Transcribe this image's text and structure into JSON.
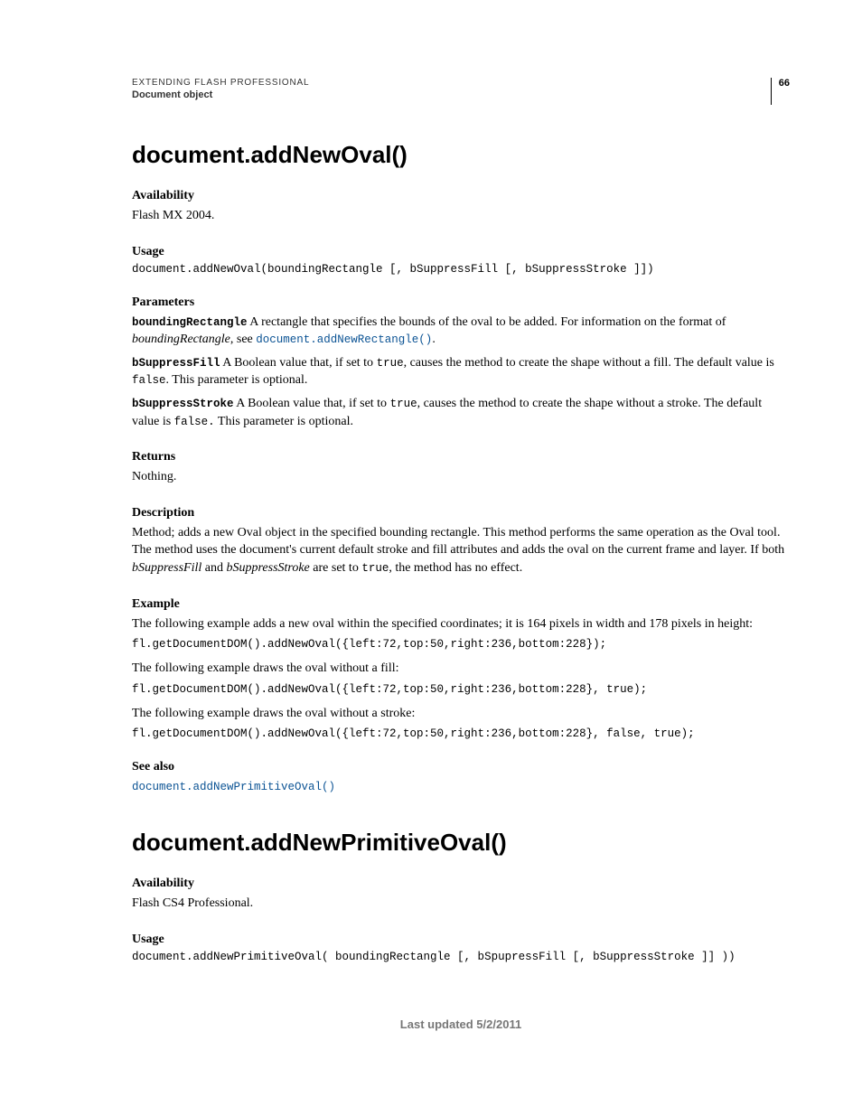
{
  "header": {
    "title": "EXTENDING FLASH PROFESSIONAL",
    "subtitle": "Document object",
    "page": "66"
  },
  "s1": {
    "title": "document.addNewOval()",
    "availability_h": "Availability",
    "availability_v": "Flash MX 2004.",
    "usage_h": "Usage",
    "usage_code": "document.addNewOval(boundingRectangle [, bSuppressFill [, bSuppressStroke ]])",
    "params_h": "Parameters",
    "p1_name": "boundingRectangle",
    "p1_text_a": "  A rectangle that specifies the bounds of the oval to be added. For information on the format of ",
    "p1_text_b_italic": "boundingRectangle",
    "p1_text_c": ", see ",
    "p1_link": "document.addNewRectangle()",
    "p1_text_d": ".",
    "p2_name": "bSuppressFill",
    "p2_text_a": "  A Boolean value that, if set to ",
    "p2_true": "true",
    "p2_text_b": ", causes the method to create the shape without a fill. The default value is ",
    "p2_false": "false",
    "p2_text_c": ". This parameter is optional.",
    "p3_name": "bSuppressStroke",
    "p3_text_a": "  A Boolean value that, if set to ",
    "p3_true": "true",
    "p3_text_b": ", causes the method to create the shape without a stroke. The default value is ",
    "p3_false": "false.",
    "p3_text_c": " This parameter is optional.",
    "returns_h": "Returns",
    "returns_v": "Nothing.",
    "desc_h": "Description",
    "desc_a": "Method; adds a new Oval object in the specified bounding rectangle. This method performs the same operation as the Oval tool. The method uses the document's current default stroke and fill attributes and adds the oval on the current frame and layer. If both ",
    "desc_b_italic": "bSuppressFill",
    "desc_c": " and ",
    "desc_d_italic": "bSuppressStroke",
    "desc_e": " are set to ",
    "desc_true": "true",
    "desc_f": ", the method has no effect.",
    "example_h": "Example",
    "ex_intro1": "The following example adds a new oval within the specified coordinates; it is 164 pixels in width and 178 pixels in height:",
    "ex_code1": "fl.getDocumentDOM().addNewOval({left:72,top:50,right:236,bottom:228});",
    "ex_intro2": "The following example draws the oval without a fill:",
    "ex_code2": "fl.getDocumentDOM().addNewOval({left:72,top:50,right:236,bottom:228}, true);",
    "ex_intro3": "The following example draws the oval without a stroke:",
    "ex_code3": "fl.getDocumentDOM().addNewOval({left:72,top:50,right:236,bottom:228}, false, true);",
    "seealso_h": "See also",
    "seealso_link": "document.addNewPrimitiveOval()"
  },
  "s2": {
    "title": "document.addNewPrimitiveOval()",
    "availability_h": "Availability",
    "availability_v": "Flash CS4 Professional.",
    "usage_h": "Usage",
    "usage_code": "document.addNewPrimitiveOval( boundingRectangle [, bSpupressFill [, bSuppressStroke ]] ))"
  },
  "footer": "Last updated 5/2/2011"
}
